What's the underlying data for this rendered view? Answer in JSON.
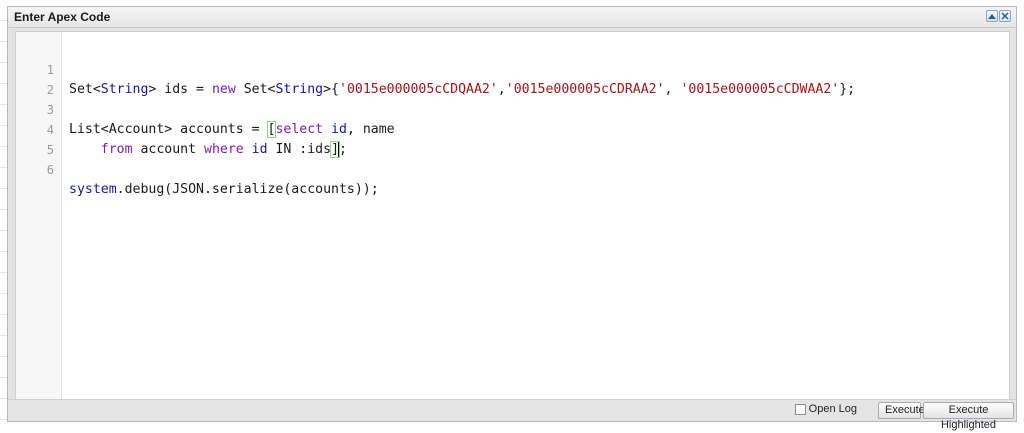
{
  "panel": {
    "title": "Enter Apex Code",
    "tools": [
      {
        "icon": "collapse-up-icon"
      },
      {
        "icon": "close-icon"
      }
    ]
  },
  "editor": {
    "line_numbers": [
      "1",
      "2",
      "3",
      "4",
      "5",
      "6"
    ],
    "code_lines": [
      "Set<String> ids = new Set<String>{'0015e000005cCDQAA2','0015e000005cCDRAA2', '0015e000005cCDWAA2'};",
      "",
      "List<Account> accounts = [select id, name",
      "    from account where id IN :ids];",
      "",
      "system.debug(JSON.serialize(accounts));"
    ],
    "tokens": {
      "l1": {
        "a": "Set<",
        "b": "String",
        "c": "> ids = ",
        "d": "new",
        "e": " Set<",
        "f": "String",
        "g": ">{",
        "h": "'0015e000005cCDQAA2'",
        "i": ",",
        "j": "'0015e000005cCDRAA2'",
        "k": ", ",
        "l": "'0015e000005cCDWAA2'",
        "m": "};"
      },
      "l3": {
        "a": "List<Account> accounts = ",
        "b": "[",
        "c": "select",
        "d": " ",
        "e": "id",
        "f": ", name"
      },
      "l4": {
        "a": "    ",
        "b": "from",
        "c": " account ",
        "d": "where",
        "e": " ",
        "f": "id",
        "g": " IN :ids",
        "h": "]",
        "i": ";"
      },
      "l6": {
        "a": "system",
        "b": ".debug(JSON.serialize(accounts));"
      }
    }
  },
  "footer": {
    "open_log_label": "Open Log",
    "open_log_checked": false,
    "execute_label": "Execute",
    "execute_highlighted_label": "Execute Highlighted"
  },
  "colors": {
    "keyword": "#7a1fa6",
    "type": "#1515a8",
    "string": "#a31515",
    "bracket_match": "#8cd98c"
  }
}
